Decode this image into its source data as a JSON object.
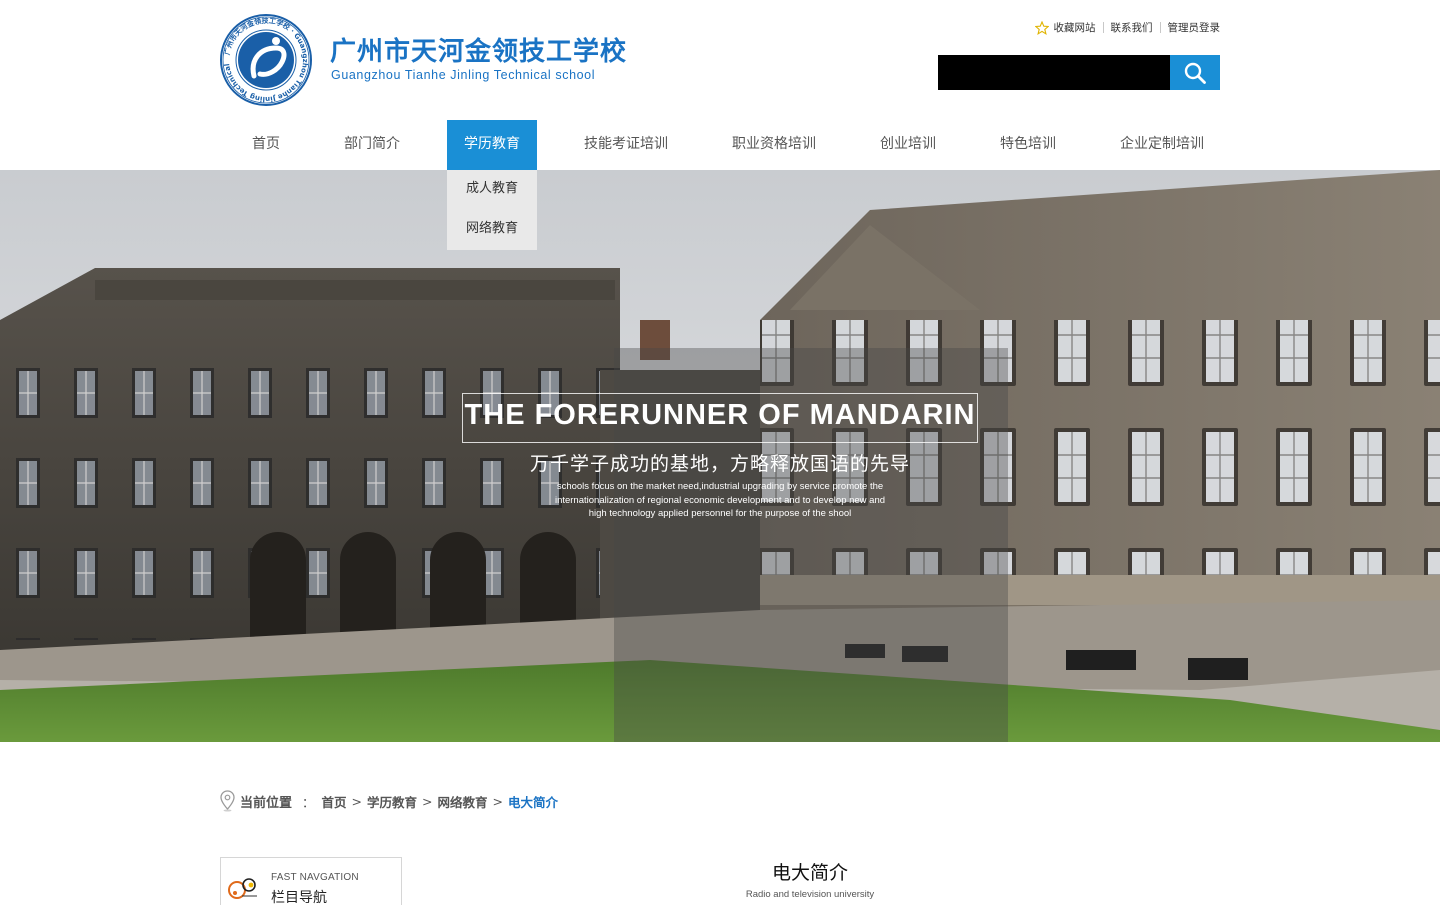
{
  "header": {
    "brand_cn": "广州市天河金领技工学校",
    "brand_en": "Guangzhou Tianhe Jinling Technical school",
    "logo_ring_text": "广州市天河金领技工学校 · Guangzhou Tianhe Jinling Technical School",
    "top_links": [
      "收藏网站",
      "联系我们",
      "管理员登录"
    ],
    "search_placeholder": ""
  },
  "nav": {
    "items": [
      "首页",
      "部门简介",
      "学历教育",
      "技能考证培训",
      "职业资格培训",
      "创业培训",
      "特色培训",
      "企业定制培训"
    ],
    "active_index": 2,
    "dropdown": [
      "成人教育",
      "网络教育"
    ]
  },
  "banner": {
    "title": "THE FORERUNNER OF MANDARIN",
    "subtitle": "万千学子成功的基地，方略释放国语的先导",
    "desc_lines": [
      "schools focus on the market need,industrial upgrading by service promote the",
      "internationalization of regional economic development and to develop new and",
      "high technology applied personnel for the purpose of the shool"
    ]
  },
  "breadcrumb": {
    "label": "当前位置",
    "colon": "：",
    "items": [
      "首页",
      "学历教育",
      "网络教育"
    ],
    "separator": ">",
    "current": "电大简介"
  },
  "sidebar": {
    "en": "FAST NAVGATION",
    "cn": "栏目导航"
  },
  "content": {
    "title": "电大简介",
    "subtitle": "Radio and television university"
  },
  "colors": {
    "accent": "#1a8fd6",
    "brand": "#1a73c4",
    "dropdown_bg": "#e9e9e9"
  },
  "icons": [
    "star-icon",
    "search-icon",
    "location-pin-icon",
    "fast-nav-icon",
    "logo-emblem"
  ]
}
